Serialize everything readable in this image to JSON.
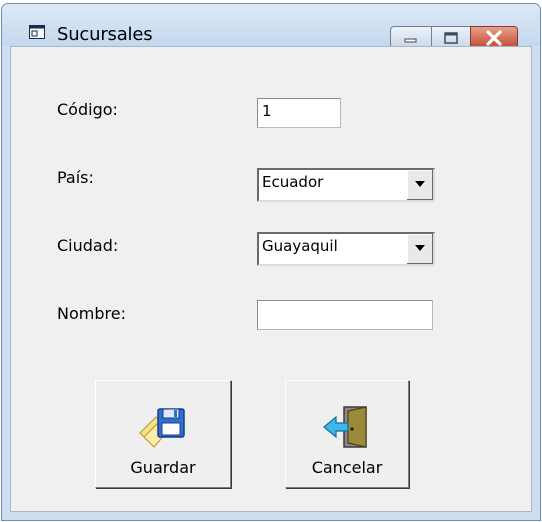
{
  "window": {
    "title": "Sucursales"
  },
  "form": {
    "codigo_label": "Código:",
    "codigo_value": "1",
    "pais_label": "País:",
    "pais_value": "Ecuador",
    "ciudad_label": "Ciudad:",
    "ciudad_value": "Guayaquil",
    "nombre_label": "Nombre:",
    "nombre_value": ""
  },
  "buttons": {
    "save_label": "Guardar",
    "save_icon": "floppy-disk-icon",
    "cancel_label": "Cancelar",
    "cancel_icon": "exit-door-icon"
  }
}
